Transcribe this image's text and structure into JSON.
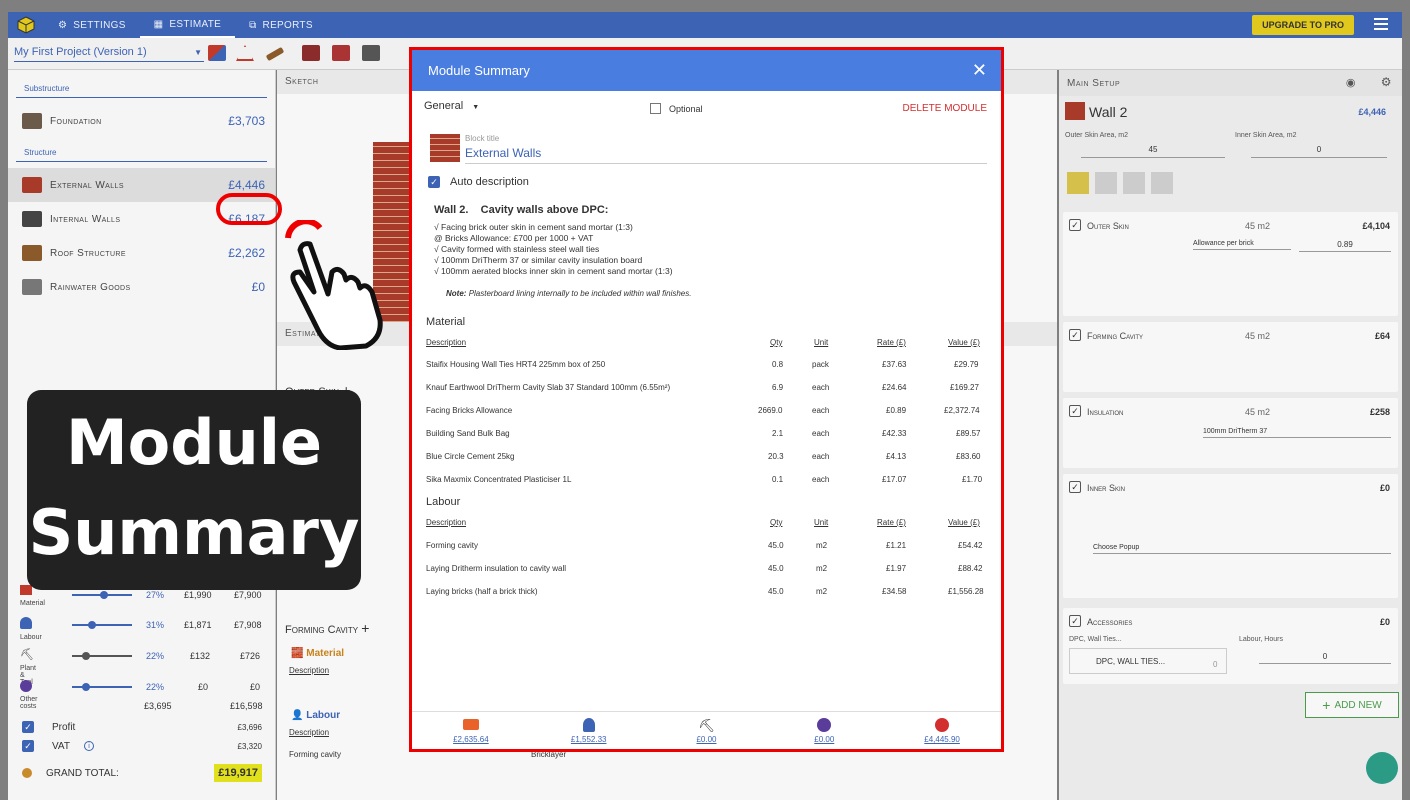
{
  "nav": {
    "settings": "SETTINGS",
    "estimate": "ESTIMATE",
    "reports": "REPORTS",
    "upgrade": "UPGRADE TO PRO"
  },
  "toolbar": {
    "project": "My First Project (Version 1)"
  },
  "left": {
    "substructure_label": "Substructure",
    "structure_label": "Structure",
    "items": [
      {
        "name": "Foundation",
        "amount": "£3,703"
      },
      {
        "name": "External Walls",
        "amount": "£4,446"
      },
      {
        "name": "Internal Walls",
        "amount": "£6,187"
      },
      {
        "name": "Roof Structure",
        "amount": "£2,262"
      },
      {
        "name": "Rainwater Goods",
        "amount": "£0"
      }
    ],
    "margins": [
      {
        "label": "Material",
        "pct": "27%",
        "amt": "£1,990",
        "total": "£7,900",
        "level": 0.27
      },
      {
        "label": "Labour",
        "pct": "31%",
        "amt": "£1,871",
        "total": "£7,908",
        "level": 0.31
      },
      {
        "label": "Plant & Tool",
        "pct": "22%",
        "amt": "£132",
        "total": "£726",
        "level": 0.22
      },
      {
        "label": "Other costs",
        "pct": "22%",
        "amt": "£0",
        "total": "£0",
        "level": 0.22
      }
    ],
    "margin_totals": {
      "amt": "£3,695",
      "total": "£16,598"
    },
    "profit_label": "Profit",
    "profit_val": "£3,696",
    "vat_label": "VAT",
    "vat_val": "£3,320",
    "grand_label": "GRAND TOTAL:",
    "grand_val": "£19,917"
  },
  "overlay": {
    "line1": "Module",
    "line2": "Summary"
  },
  "mid": {
    "sketch": "Sketch",
    "estimate": "Estimate",
    "outer_skin": "Outer Skin",
    "forming_cavity": "Forming Cavity",
    "material": "Material",
    "labour": "Labour",
    "description": "Description",
    "forming_cavity_row": "Forming cavity",
    "bricklayer": "Bricklayer"
  },
  "right": {
    "title": "Main Setup",
    "wall": "Wall 2",
    "wall_price": "£4,446",
    "outer_area_label": "Outer Skin Area, m2",
    "outer_area": "45",
    "inner_area_label": "Inner Skin Area, m2",
    "inner_area": "0",
    "cards": [
      {
        "title": "Outer Skin",
        "m2": "45 m2",
        "price": "£4,104"
      },
      {
        "title": "Forming Cavity",
        "m2": "45 m2",
        "price": "£64"
      },
      {
        "title": "Insulation",
        "m2": "45 m2",
        "price": "£258"
      },
      {
        "title": "Inner Skin",
        "m2": "",
        "price": "£0"
      },
      {
        "title": "Accessories",
        "m2": "",
        "price": "£0"
      }
    ],
    "allowance": "Allowance per brick",
    "allowance_val": "0.89",
    "insulation_sel": "100mm DriTherm 37",
    "inner_sel": "Choose Popup",
    "ties_label": "DPC, Wall Ties...",
    "ties_btn": "DPC, WALL TIES...",
    "ties_val": "0",
    "labour_hours_label": "Labour, Hours",
    "labour_hours_val": "0",
    "add_new": "ADD NEW"
  },
  "modal": {
    "title": "Module Summary",
    "general": "General",
    "optional": "Optional",
    "delete": "DELETE MODULE",
    "block_title_label": "Block title",
    "block_title": "External Walls",
    "auto_desc": "Auto description",
    "wall_heading": "Wall 2.    Cavity walls above DPC:",
    "spec_lines": [
      "√ Facing brick outer skin in cement sand mortar (1:3)",
      "@ Bricks Allowance: £700 per 1000 + VAT",
      "√ Cavity formed with stainless steel wall ties",
      "√ 100mm DriTherm 37 or similar cavity insulation board",
      "√ 100mm aerated blocks inner skin in cement sand mortar (1:3)"
    ],
    "note_label": "Note:",
    "note": "Plasterboard lining internally to be included within wall finishes.",
    "material_heading": "Material",
    "labour_heading": "Labour",
    "cols": {
      "description": "Description",
      "qty": "Qty",
      "unit": "Unit",
      "rate": "Rate (£)",
      "value": "Value (£)"
    },
    "material_rows": [
      {
        "desc": "Staifix Housing Wall Ties HRT4 225mm box of 250",
        "qty": "0.8",
        "unit": "pack",
        "rate": "£37.63",
        "value": "£29.79"
      },
      {
        "desc": "Knauf Earthwool DriTherm Cavity Slab 37 Standard 100mm (6.55m²)",
        "qty": "6.9",
        "unit": "each",
        "rate": "£24.64",
        "value": "£169.27"
      },
      {
        "desc": "Facing Bricks Allowance",
        "qty": "2669.0",
        "unit": "each",
        "rate": "£0.89",
        "value": "£2,372.74"
      },
      {
        "desc": "Building Sand Bulk Bag",
        "qty": "2.1",
        "unit": "each",
        "rate": "£42.33",
        "value": "£89.57"
      },
      {
        "desc": "Blue Circle Cement 25kg",
        "qty": "20.3",
        "unit": "each",
        "rate": "£4.13",
        "value": "£83.60"
      },
      {
        "desc": "Sika Maxmix Concentrated Plasticiser 1L",
        "qty": "0.1",
        "unit": "each",
        "rate": "£17.07",
        "value": "£1.70"
      }
    ],
    "labour_rows": [
      {
        "desc": "Forming cavity",
        "qty": "45.0",
        "unit": "m2",
        "rate": "£1.21",
        "value": "£54.42"
      },
      {
        "desc": "Laying Dritherm insulation to cavity wall",
        "qty": "45.0",
        "unit": "m2",
        "rate": "£1.97",
        "value": "£88.42"
      },
      {
        "desc": "Laying bricks (half a brick thick)",
        "qty": "45.0",
        "unit": "m2",
        "rate": "£34.58",
        "value": "£1,556.28"
      }
    ],
    "footer": [
      {
        "value": "£2,635.64",
        "icon": "brick-icon"
      },
      {
        "value": "£1,552.33",
        "icon": "worker-icon"
      },
      {
        "value": "£0.00",
        "icon": "plant-icon"
      },
      {
        "value": "£0.00",
        "icon": "coins-icon"
      },
      {
        "value": "£4,445.90",
        "icon": "total-icon"
      }
    ]
  },
  "colors": {
    "accent": "#3d63b5",
    "modal_head": "#4a7de0",
    "highlight": "#e00000",
    "upgrade": "#e1c81c"
  }
}
